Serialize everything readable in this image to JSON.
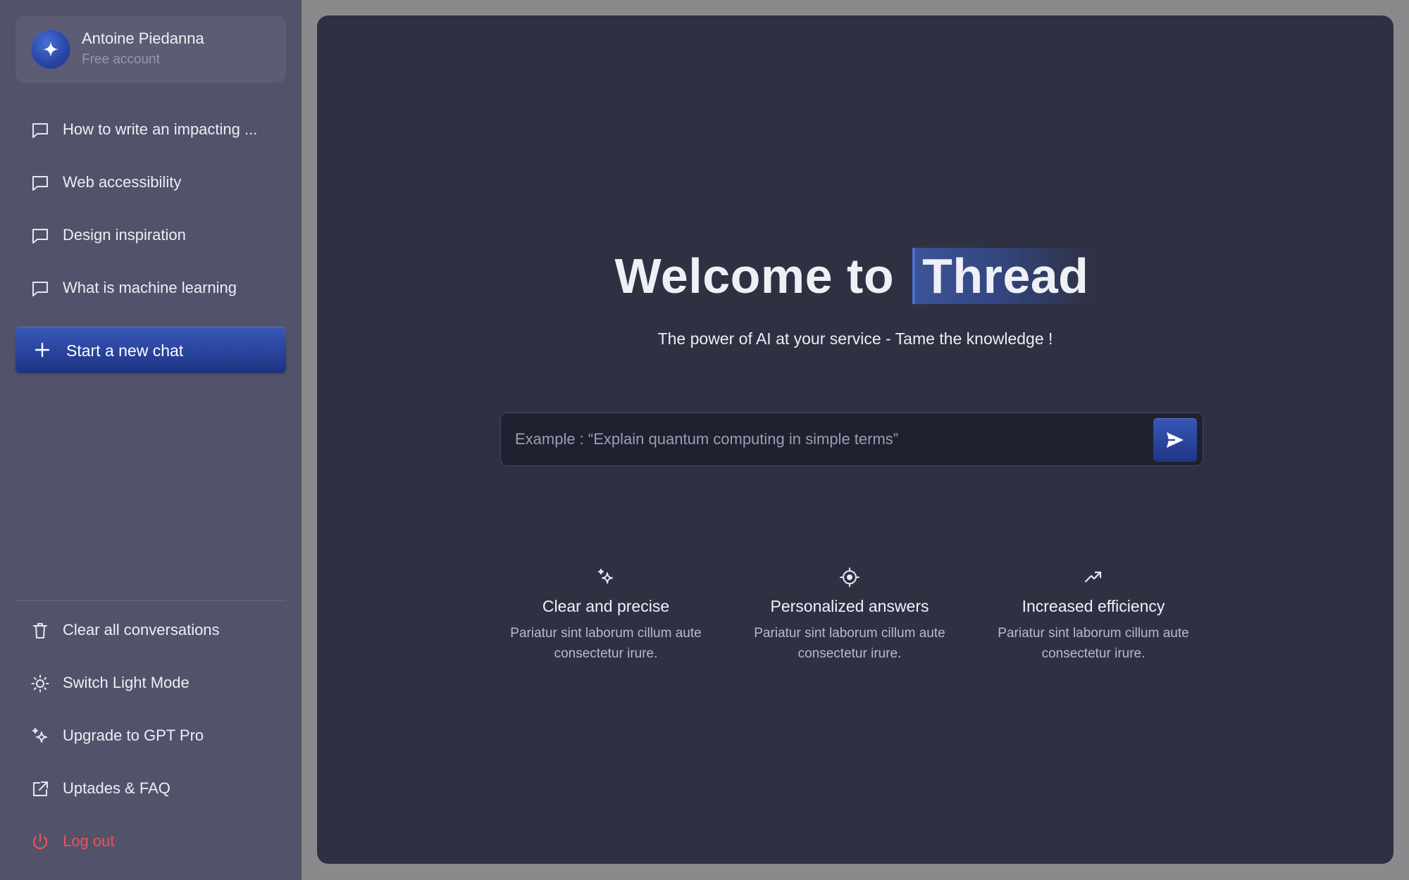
{
  "account": {
    "name": "Antoine Piedanna",
    "plan": "Free account",
    "avatar_icon": "sparkle-icon"
  },
  "conversations": [
    {
      "label": "How to write an impacting ...",
      "icon": "chat-bubble-icon"
    },
    {
      "label": "Web accessibility",
      "icon": "chat-bubble-icon"
    },
    {
      "label": "Design inspiration",
      "icon": "chat-bubble-icon"
    },
    {
      "label": "What is machine learning",
      "icon": "chat-bubble-icon"
    }
  ],
  "new_chat": {
    "label": "Start a new chat",
    "icon": "plus-icon"
  },
  "bottom_menu": [
    {
      "label": "Clear all conversations",
      "icon": "trash-icon"
    },
    {
      "label": "Switch Light Mode",
      "icon": "sun-icon"
    },
    {
      "label": "Upgrade to GPT Pro",
      "icon": "sparkles-icon"
    },
    {
      "label": "Uptades & FAQ",
      "icon": "external-link-icon"
    },
    {
      "label": "Log out",
      "icon": "power-icon"
    }
  ],
  "main": {
    "welcome_prefix": "Welcome to",
    "welcome_brand": "Thread",
    "subtitle": "The power of AI at your service - Tame the knowledge !",
    "search_placeholder": "Example : “Explain quantum computing in simple terms”",
    "search_value": "",
    "send_icon": "send-icon"
  },
  "features": [
    {
      "title": "Clear and precise",
      "description": "Pariatur sint laborum cillum aute consectetur irure.",
      "icon": "sparkles-icon"
    },
    {
      "title": "Personalized answers",
      "description": "Pariatur sint laborum cillum aute consectetur irure.",
      "icon": "target-icon"
    },
    {
      "title": "Increased efficiency",
      "description": "Pariatur sint laborum cillum aute consectetur irure.",
      "icon": "trending-up-icon"
    }
  ],
  "colors": {
    "sidebar_bg": "#52536a",
    "main_bg": "#2f3142",
    "accent": "#2a449c",
    "danger": "#e8545a"
  }
}
